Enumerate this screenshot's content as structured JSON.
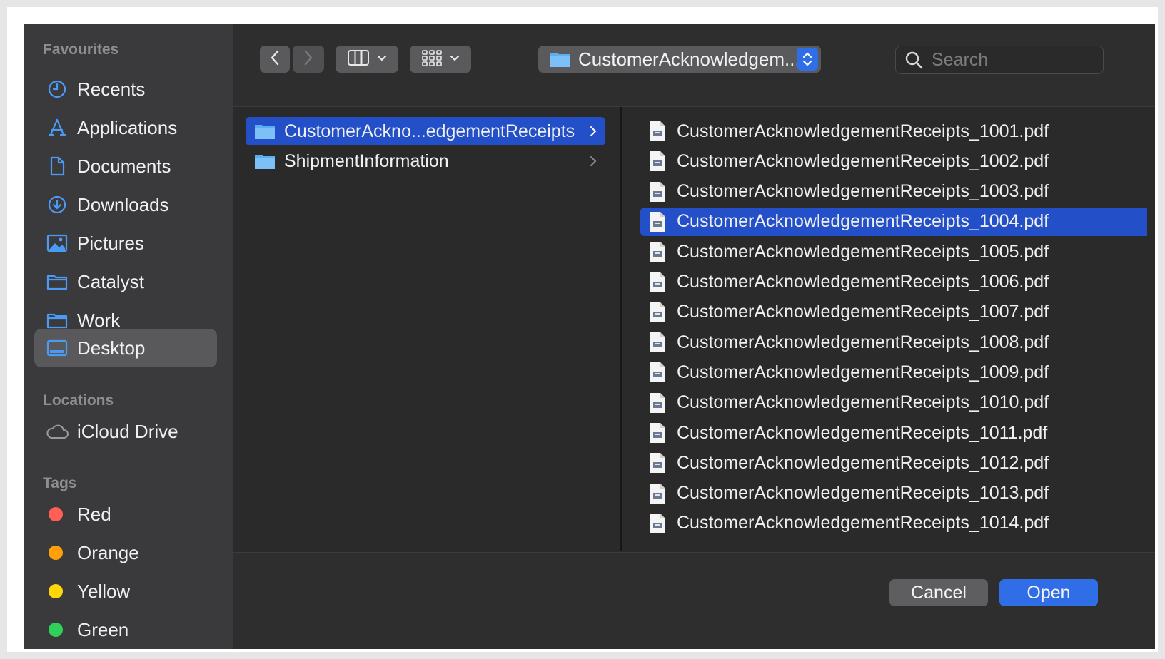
{
  "sidebar": {
    "favourites_title": "Favourites",
    "favourites": [
      {
        "label": "Recents",
        "icon": "clock-icon"
      },
      {
        "label": "Applications",
        "icon": "applications-icon"
      },
      {
        "label": "Documents",
        "icon": "document-icon"
      },
      {
        "label": "Downloads",
        "icon": "download-icon"
      },
      {
        "label": "Pictures",
        "icon": "pictures-icon"
      },
      {
        "label": "Catalyst",
        "icon": "folder-icon"
      },
      {
        "label": "Work",
        "icon": "folder-icon"
      },
      {
        "label": "Desktop",
        "icon": "desktop-icon",
        "selected": true
      }
    ],
    "locations_title": "Locations",
    "locations": [
      {
        "label": "iCloud Drive",
        "icon": "cloud-icon"
      }
    ],
    "tags_title": "Tags",
    "tags": [
      {
        "label": "Red",
        "color": "#ff5f57"
      },
      {
        "label": "Orange",
        "color": "#ff9f0a"
      },
      {
        "label": "Yellow",
        "color": "#ffd60a"
      },
      {
        "label": "Green",
        "color": "#30d158"
      }
    ]
  },
  "toolbar": {
    "path_label": "CustomerAcknowledgem...",
    "search_placeholder": "Search"
  },
  "column1": {
    "items": [
      {
        "label": "CustomerAckno...edgementReceipts",
        "selected": true
      },
      {
        "label": "ShipmentInformation",
        "selected": false
      }
    ]
  },
  "column2": {
    "files": [
      "CustomerAcknowledgementReceipts_1001.pdf",
      "CustomerAcknowledgementReceipts_1002.pdf",
      "CustomerAcknowledgementReceipts_1003.pdf",
      "CustomerAcknowledgementReceipts_1004.pdf",
      "CustomerAcknowledgementReceipts_1005.pdf",
      "CustomerAcknowledgementReceipts_1006.pdf",
      "CustomerAcknowledgementReceipts_1007.pdf",
      "CustomerAcknowledgementReceipts_1008.pdf",
      "CustomerAcknowledgementReceipts_1009.pdf",
      "CustomerAcknowledgementReceipts_1010.pdf",
      "CustomerAcknowledgementReceipts_1011.pdf",
      "CustomerAcknowledgementReceipts_1012.pdf",
      "CustomerAcknowledgementReceipts_1013.pdf",
      "CustomerAcknowledgementReceipts_1014.pdf"
    ],
    "selected_file": "CustomerAcknowledgementReceipts_1004.pdf"
  },
  "footer": {
    "cancel_label": "Cancel",
    "open_label": "Open"
  },
  "colors": {
    "accent": "#2f6ee6",
    "selection": "#2350c8",
    "sidebar_icon": "#4a9bf5"
  }
}
